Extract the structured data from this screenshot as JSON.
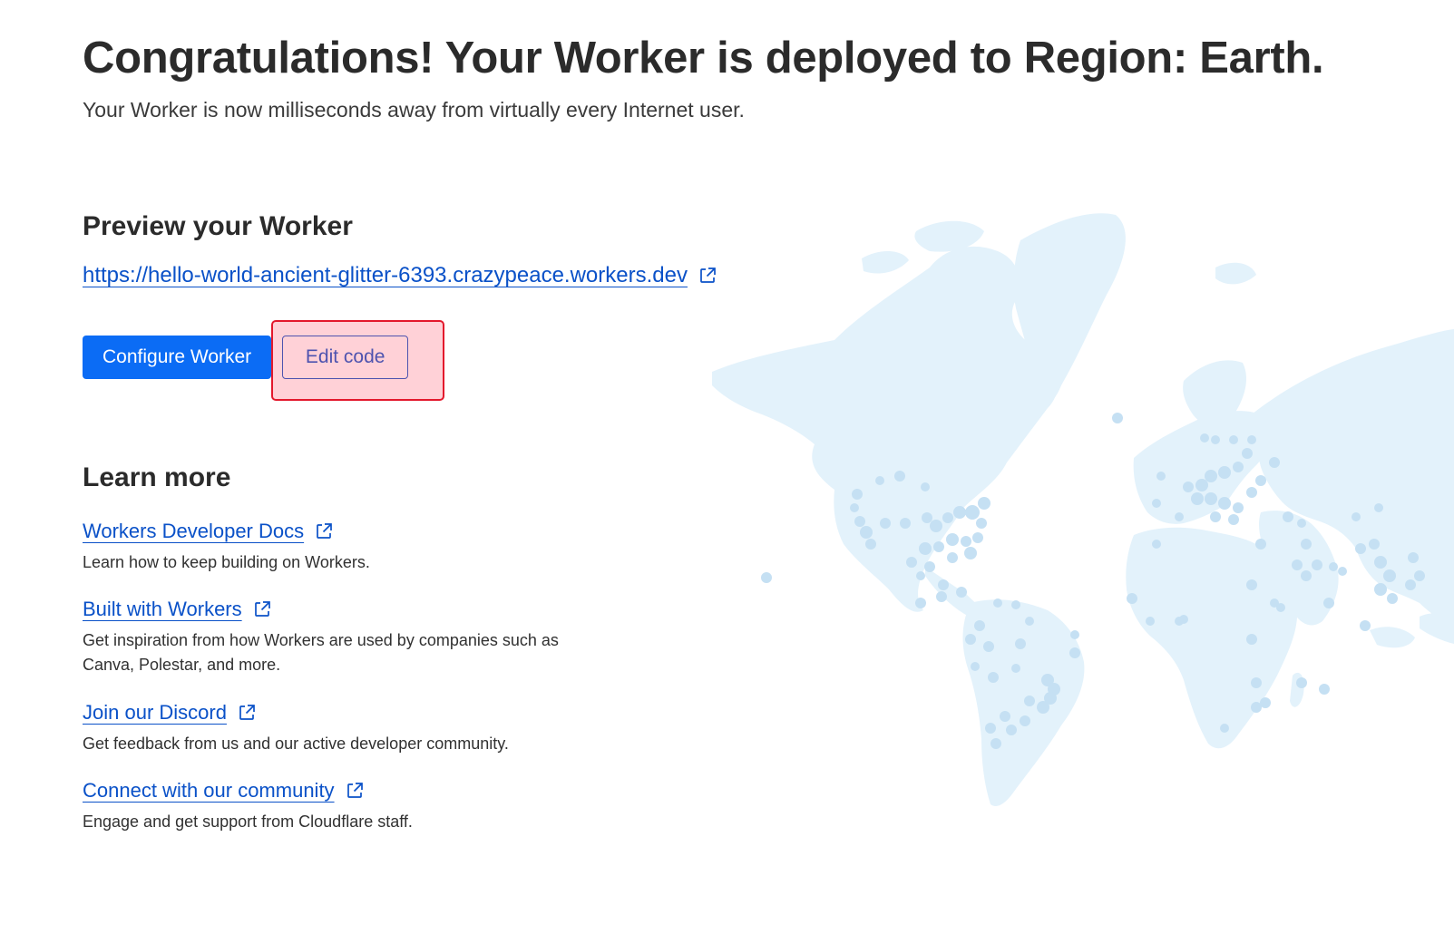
{
  "header": {
    "title": "Congratulations! Your Worker is deployed to Region: Earth.",
    "subtitle": "Your Worker is now milliseconds away from virtually every Internet user."
  },
  "preview": {
    "title": "Preview your Worker",
    "url": "https://hello-world-ancient-glitter-6393.crazypeace.workers.dev",
    "icon": "external-link-icon"
  },
  "actions": {
    "configure_label": "Configure Worker",
    "edit_label": "Edit code"
  },
  "learn_more": {
    "title": "Learn more",
    "items": [
      {
        "label": "Workers Developer Docs",
        "description": "Learn how to keep building on Workers."
      },
      {
        "label": "Built with Workers",
        "description": "Get inspiration from how Workers are used by companies such as Canva, Polestar, and more."
      },
      {
        "label": "Join our Discord",
        "description": "Get feedback from us and our active developer community."
      },
      {
        "label": "Connect with our community",
        "description": "Engage and get support from Cloudflare staff."
      }
    ]
  },
  "colors": {
    "link": "#0a51c8",
    "primary_button": "#0b6cf5",
    "map_land": "#e3f2fb",
    "map_dot": "#c5e0f3",
    "highlight": "#e3182c"
  }
}
